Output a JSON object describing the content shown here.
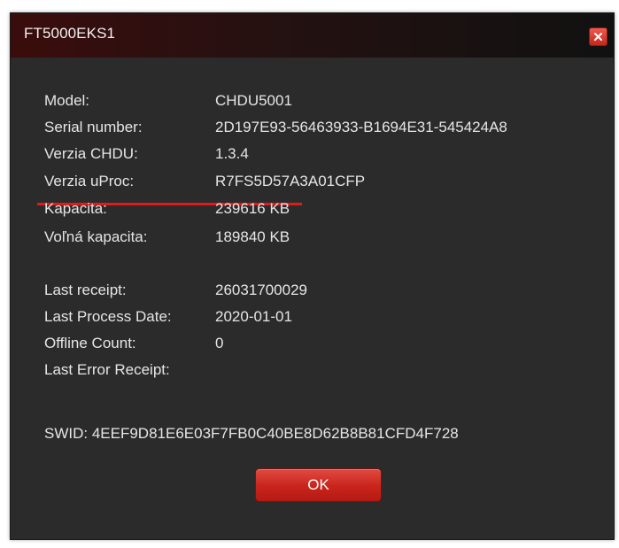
{
  "window": {
    "title": "FT5000EKS1",
    "close_icon": "close-icon"
  },
  "info": [
    {
      "label": "Model:",
      "value": "CHDU5001"
    },
    {
      "label": "Serial number:",
      "value": "2D197E93-56463933-B1694E31-545424A8"
    },
    {
      "label": "Verzia CHDU:",
      "value": "1.3.4"
    },
    {
      "label": "Verzia uProc:",
      "value": "R7FS5D57A3A01CFP"
    },
    {
      "label": "Kapacita:",
      "value": "239616 KB"
    },
    {
      "label": "Voľná kapacita:",
      "value": "189840 KB"
    }
  ],
  "receipt": [
    {
      "label": "Last receipt:",
      "value": "26031700029"
    },
    {
      "label": "Last Process Date:",
      "value": "2020-01-01"
    },
    {
      "label": "Offline Count:",
      "value": "0"
    },
    {
      "label": "Last Error Receipt:",
      "value": ""
    }
  ],
  "swid": "SWID: 4EEF9D81E6E03F7FB0C40BE8D62B8B81CFD4F728",
  "buttons": {
    "ok_label": "OK"
  },
  "colors": {
    "accent": "#e01b1b",
    "background": "#2b2b2b",
    "text": "#e6e6e6"
  }
}
